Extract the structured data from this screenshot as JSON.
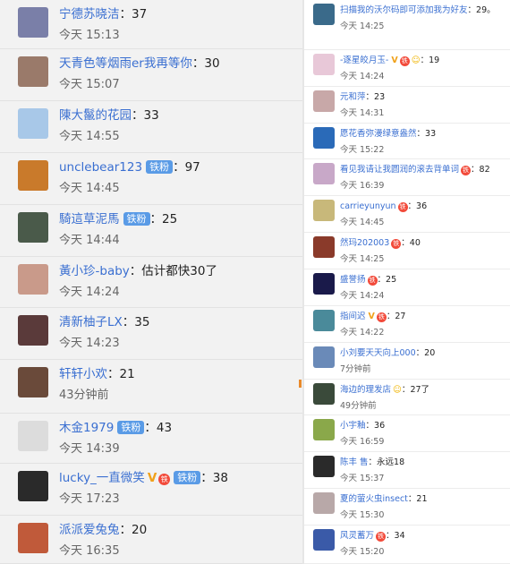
{
  "left_comments": [
    {
      "name": "宁德苏晓洁",
      "count": "37",
      "time": "今天 15:13",
      "badge": "",
      "v": false,
      "lvl": false,
      "avatar_color": "#7a7fa8"
    },
    {
      "name": "天青色等烟雨er我再等你",
      "count": "30",
      "time": "今天 15:07",
      "badge": "",
      "v": false,
      "lvl": false,
      "avatar_color": "#9a7a6a"
    },
    {
      "name": "陳大鬣的花园",
      "count": "33",
      "time": "今天 14:55",
      "badge": "",
      "v": false,
      "lvl": false,
      "avatar_color": "#a8c8e8"
    },
    {
      "name": "unclebear123",
      "count": "97",
      "time": "今天 14:45",
      "badge": "铁粉",
      "v": false,
      "lvl": false,
      "avatar_color": "#c97a2b"
    },
    {
      "name": "騎這草泥馬",
      "count": "25",
      "time": "今天 14:44",
      "badge": "铁粉",
      "v": false,
      "lvl": false,
      "avatar_color": "#4a5a4a"
    },
    {
      "name": "黃小珍-baby",
      "count": "估计都快30了",
      "time": "今天 14:24",
      "badge": "",
      "v": false,
      "lvl": false,
      "avatar_color": "#c99a8a"
    },
    {
      "name": "清新柚子LX",
      "count": "35",
      "time": "今天 14:23",
      "badge": "",
      "v": false,
      "lvl": false,
      "avatar_color": "#5a3a3a"
    },
    {
      "name": "轩轩小欢",
      "count": "21",
      "time": "43分钟前",
      "badge": "",
      "v": false,
      "lvl": false,
      "avatar_color": "#6a4a3a"
    },
    {
      "name": "木金1979",
      "count": "43",
      "time": "今天 14:39",
      "badge": "铁粉",
      "v": false,
      "lvl": false,
      "avatar_color": "#dcdcdc"
    },
    {
      "name": "lucky_一直微笑",
      "count": "38",
      "time": "今天 17:23",
      "badge": "铁粉",
      "v": true,
      "lvl": true,
      "avatar_color": "#2a2a2a"
    },
    {
      "name": "派派爱兔兔",
      "count": "20",
      "time": "今天 16:35",
      "badge": "",
      "v": false,
      "lvl": false,
      "avatar_color": "#c05a3a"
    }
  ],
  "right_comments": [
    {
      "name": "扫描我的沃尔码即可添加我为好友",
      "count": "29。",
      "time": "今天 14:25",
      "badge": "",
      "v": false,
      "lvl": false,
      "emoji": false,
      "avatar_color": "#3a6a8a"
    },
    {
      "name": "-逐星皎月玉-",
      "count": "19",
      "time": "今天 14:24",
      "badge": "",
      "v": true,
      "lvl": true,
      "emoji": true,
      "avatar_color": "#e8c8d8"
    },
    {
      "name": "元和萍",
      "count": "23",
      "time": "今天 14:31",
      "badge": "",
      "v": false,
      "lvl": false,
      "emoji": false,
      "avatar_color": "#c8a8a8"
    },
    {
      "name": "愿花香弥漫绿意盎然",
      "count": "33",
      "time": "今天 15:22",
      "badge": "",
      "v": false,
      "lvl": false,
      "emoji": false,
      "avatar_color": "#2a6ab8"
    },
    {
      "name": "看见我请让我圆润的滚去背单词",
      "count": "82",
      "time": "今天 16:39",
      "badge": "",
      "v": false,
      "lvl": true,
      "emoji": false,
      "avatar_color": "#c8a8c8"
    },
    {
      "name": "carrieyunyun",
      "count": "36",
      "time": "今天 14:45",
      "badge": "",
      "v": false,
      "lvl": true,
      "emoji": false,
      "avatar_color": "#c8b87a"
    },
    {
      "name": "然玛202003",
      "count": "40",
      "time": "今天 14:25",
      "badge": "",
      "v": false,
      "lvl": true,
      "emoji": false,
      "avatar_color": "#8a3a2a"
    },
    {
      "name": "盛誉扬",
      "count": "25",
      "time": "今天 14:24",
      "badge": "",
      "v": false,
      "lvl": true,
      "emoji": false,
      "avatar_color": "#1a1a4a"
    },
    {
      "name": "指间迟",
      "count": "27",
      "time": "今天 14:22",
      "badge": "",
      "v": true,
      "lvl": true,
      "emoji": false,
      "avatar_color": "#4a8a9a"
    },
    {
      "name": "小刘要天天向上000",
      "count": "20",
      "time": "7分钟前",
      "badge": "",
      "v": false,
      "lvl": false,
      "emoji": false,
      "avatar_color": "#6a8ab8"
    },
    {
      "name": "海边的理发店",
      "count": "27了",
      "time": "49分钟前",
      "badge": "",
      "v": false,
      "lvl": false,
      "emoji": true,
      "avatar_color": "#3a4a3a"
    },
    {
      "name": "小宇釉",
      "count": "36",
      "time": "今天 16:59",
      "badge": "",
      "v": false,
      "lvl": false,
      "emoji": false,
      "avatar_color": "#8aa84a"
    },
    {
      "name": "陈丰 售",
      "count": "永远18",
      "time": "今天 15:37",
      "badge": "",
      "v": false,
      "lvl": false,
      "emoji": false,
      "avatar_color": "#2a2a2a"
    },
    {
      "name": "夏的萤火虫insect",
      "count": "21",
      "time": "今天 15:30",
      "badge": "",
      "v": false,
      "lvl": false,
      "emoji": false,
      "avatar_color": "#b8a8a8"
    },
    {
      "name": "风灵蓄万",
      "count": "34",
      "time": "今天 15:20",
      "badge": "",
      "v": false,
      "lvl": true,
      "emoji": false,
      "avatar_color": "#3a5aa8"
    }
  ],
  "labels": {
    "v_mark": "V",
    "lvl_mark": "铁",
    "emoji_mark": "☺",
    "colon": "："
  }
}
